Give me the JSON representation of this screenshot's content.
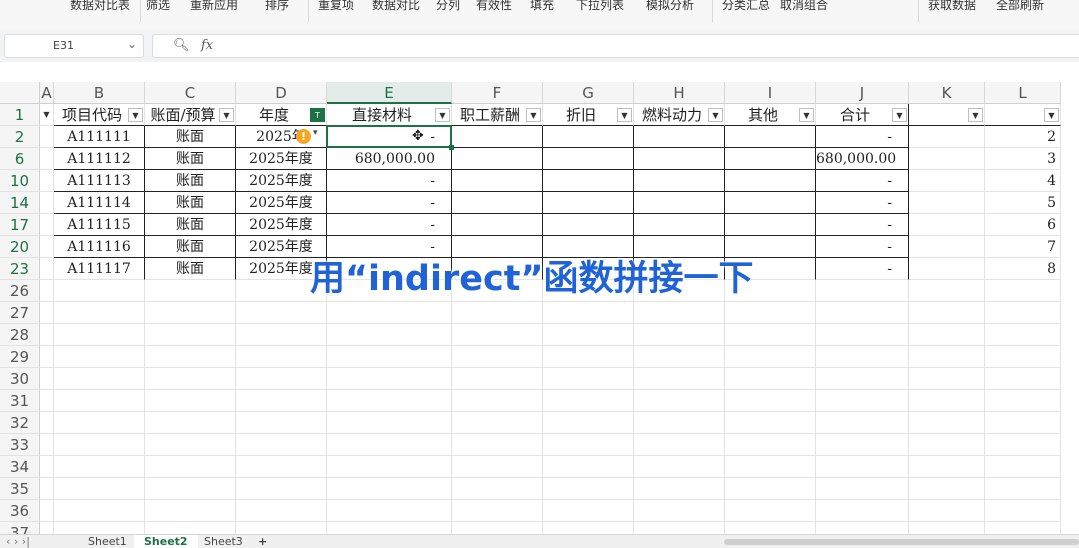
{
  "toolbar": {
    "items": [
      "数据对比表",
      "筛选",
      "重新应用",
      "排序",
      "重复项",
      "数据对比",
      "分列",
      "有效性",
      "填充",
      "下拉列表",
      "模拟分析",
      "分类汇总",
      "取消组合",
      "获取数据",
      "全部刷新"
    ]
  },
  "formula_bar": {
    "name_box": "E31",
    "zoom_icon": "zoom-icon",
    "fx_label": "fx",
    "value": ""
  },
  "columns": [
    "A",
    "B",
    "C",
    "D",
    "E",
    "F",
    "G",
    "H",
    "I",
    "J",
    "K",
    "L"
  ],
  "active_column": "E",
  "header_row": {
    "row_number": "1",
    "labels": {
      "B": "项目代码",
      "C": "账面/预算",
      "D": "年度",
      "E": "直接材料",
      "F": "职工薪酬",
      "G": "折旧",
      "H": "燃料动力",
      "I": "其他",
      "J": "合计",
      "K": "",
      "L": ""
    }
  },
  "data_rows": [
    {
      "row": "2",
      "code": "A111111",
      "type": "账面",
      "year": "2025年",
      "direct": "-",
      "total": "-",
      "l": "2"
    },
    {
      "row": "6",
      "code": "A111112",
      "type": "账面",
      "year": "2025年度",
      "direct": "680,000.00",
      "total": "680,000.00",
      "l": "3"
    },
    {
      "row": "10",
      "code": "A111113",
      "type": "账面",
      "year": "2025年度",
      "direct": "-",
      "total": "-",
      "l": "4"
    },
    {
      "row": "14",
      "code": "A111114",
      "type": "账面",
      "year": "2025年度",
      "direct": "-",
      "total": "-",
      "l": "5"
    },
    {
      "row": "17",
      "code": "A111115",
      "type": "账面",
      "year": "2025年度",
      "direct": "-",
      "total": "-",
      "l": "6"
    },
    {
      "row": "20",
      "code": "A111116",
      "type": "账面",
      "year": "2025年度",
      "direct": "-",
      "total": "-",
      "l": "7"
    },
    {
      "row": "23",
      "code": "A111117",
      "type": "账面",
      "year": "2025年度",
      "direct": "",
      "total": "-",
      "l": "8"
    }
  ],
  "empty_rows": [
    "26",
    "27",
    "28",
    "29",
    "30",
    "31",
    "32",
    "33",
    "34",
    "35",
    "36",
    "37"
  ],
  "overlay_caption": "用“indirect”函数拼接一下",
  "sheet_tabs": {
    "sheets": [
      "Sheet1",
      "Sheet2",
      "Sheet3"
    ],
    "active": "Sheet2",
    "add_label": "+"
  },
  "colors": {
    "accent_green": "#1e7145",
    "caption_blue": "#1f63d6",
    "warning_orange": "#f5a623"
  }
}
